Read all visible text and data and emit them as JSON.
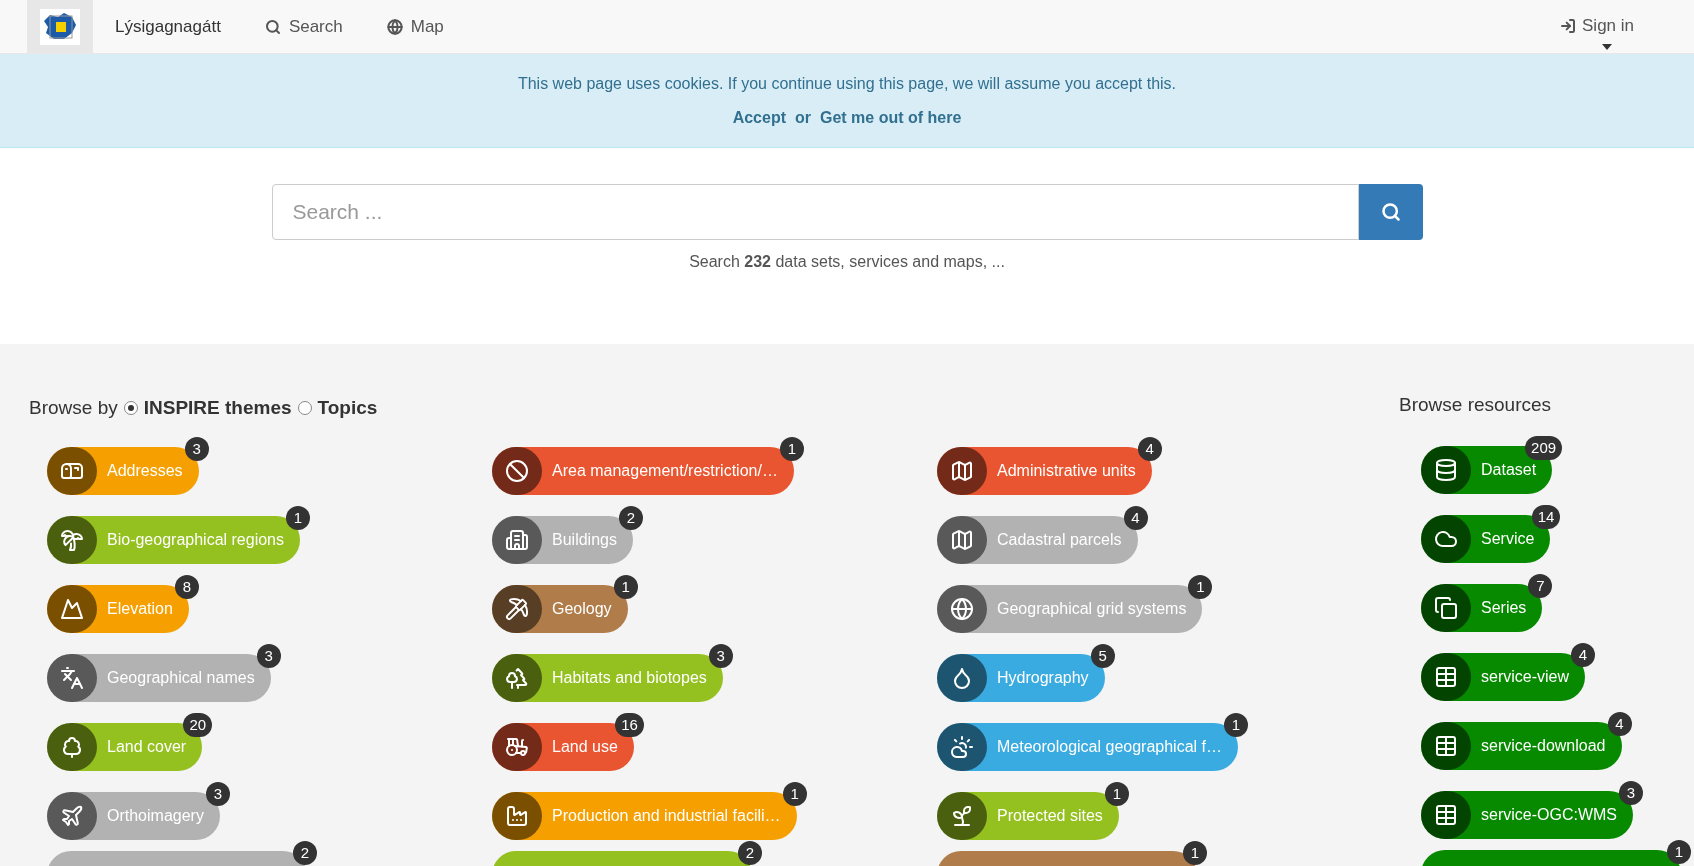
{
  "navbar": {
    "brand": "Lýsigagnagátt",
    "links": [
      {
        "label": "Search"
      },
      {
        "label": "Map"
      }
    ],
    "sign_in": "Sign in"
  },
  "cookie_banner": {
    "message": "This web page uses cookies. If you continue using this page, we will assume you accept this.",
    "accept": "Accept",
    "or": "or",
    "decline": "Get me out of here"
  },
  "search": {
    "placeholder": "Search ...",
    "summary": "Search **232** data sets, services and maps, ..."
  },
  "browse": {
    "label": "Browse by",
    "options": [
      {
        "label": "INSPIRE themes",
        "selected": true
      },
      {
        "label": "Topics",
        "selected": false
      }
    ],
    "columns": [
      [
        {
          "kind": "full",
          "label": "Addresses",
          "count": "3",
          "color": "#f5a000"
        },
        {
          "kind": "full",
          "label": "Bio-geographical regions",
          "count": "1",
          "color": "#94c11f"
        },
        {
          "kind": "full",
          "label": "Elevation",
          "count": "8",
          "color": "#f5a000"
        },
        {
          "kind": "full",
          "label": "Geographical names",
          "count": "3",
          "color": "#b2b2b2"
        },
        {
          "kind": "full",
          "label": "Land cover",
          "count": "20",
          "color": "#94c11f"
        },
        {
          "kind": "full",
          "label": "Orthoimagery",
          "count": "3",
          "color": "#b2b2b2"
        },
        {
          "kind": "partial",
          "count": "2",
          "color": "#b2b2b2"
        }
      ],
      [
        {
          "kind": "full",
          "label": "Area management/restriction/…",
          "count": "1",
          "color": "#e85530"
        },
        {
          "kind": "full",
          "label": "Buildings",
          "count": "2",
          "color": "#b2b2b2"
        },
        {
          "kind": "full",
          "label": "Geology",
          "count": "1",
          "color": "#b07d4a"
        },
        {
          "kind": "full",
          "label": "Habitats and biotopes",
          "count": "3",
          "color": "#94c11f"
        },
        {
          "kind": "full",
          "label": "Land use",
          "count": "16",
          "color": "#e85530"
        },
        {
          "kind": "full",
          "label": "Production and industrial facili…",
          "count": "1",
          "color": "#f5a000"
        },
        {
          "kind": "partial",
          "count": "2",
          "color": "#94c11f"
        }
      ],
      [
        {
          "kind": "full",
          "label": "Administrative units",
          "count": "4",
          "color": "#e85530"
        },
        {
          "kind": "full",
          "label": "Cadastral parcels",
          "count": "4",
          "color": "#b2b2b2"
        },
        {
          "kind": "full",
          "label": "Geographical grid systems",
          "count": "1",
          "color": "#b2b2b2"
        },
        {
          "kind": "full",
          "label": "Hydrography",
          "count": "5",
          "color": "#3aabe0"
        },
        {
          "kind": "full",
          "label": "Meteorological geographical f…",
          "count": "1",
          "color": "#3aabe0"
        },
        {
          "kind": "full",
          "label": "Protected sites",
          "count": "1",
          "color": "#94c11f"
        },
        {
          "kind": "partial",
          "count": "1",
          "color": "#b07d4a"
        }
      ]
    ]
  },
  "resources": {
    "title": "Browse resources",
    "items": [
      {
        "kind": "full",
        "label": "Dataset",
        "count": "209",
        "color": "#078a00"
      },
      {
        "kind": "full",
        "label": "Service",
        "count": "14",
        "color": "#078a00"
      },
      {
        "kind": "full",
        "label": "Series",
        "count": "7",
        "color": "#078a00"
      },
      {
        "kind": "full",
        "label": "service-view",
        "count": "4",
        "color": "#078a00"
      },
      {
        "kind": "full",
        "label": "service-download",
        "count": "4",
        "color": "#078a00"
      },
      {
        "kind": "full",
        "label": "service-OGC:WMS",
        "count": "3",
        "color": "#078a00"
      },
      {
        "kind": "partial",
        "count": "1",
        "color": "#078a00"
      }
    ]
  }
}
